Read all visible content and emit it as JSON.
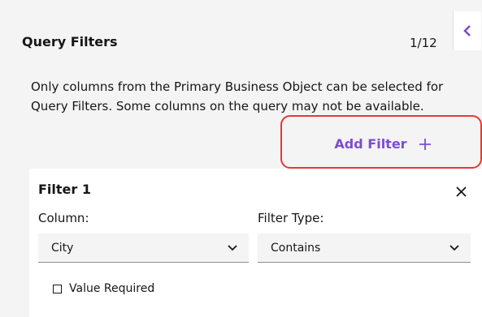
{
  "panel": {
    "title": "Query Filters",
    "counter": "1/12",
    "description": "Only columns from the Primary Business Object can be selected for Query Filters. Some columns on the query may not be available."
  },
  "buttons": {
    "add_filter_label": "Add Filter"
  },
  "icons": {
    "collapse": "chevron-left-icon",
    "add": "plus-icon",
    "close": "close-icon",
    "dropdown": "chevron-down-icon"
  },
  "filter": {
    "title": "Filter 1",
    "column_label": "Column:",
    "column_value": "City",
    "filter_type_label": "Filter Type:",
    "filter_type_value": "Contains",
    "value_required_label": "Value Required",
    "value_required_checked": false
  },
  "colors": {
    "accent": "#7d4dd1",
    "highlight": "#e53935",
    "background": "#f4f4f4",
    "card": "#ffffff"
  }
}
